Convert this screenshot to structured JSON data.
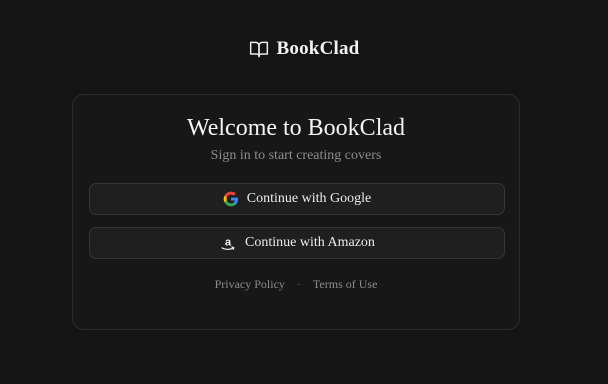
{
  "brand": {
    "name": "BookClad",
    "icon": "open-book-icon"
  },
  "card": {
    "title": "Welcome to BookClad",
    "subtitle": "Sign in to start creating covers"
  },
  "buttons": {
    "google": {
      "label": "Continue with Google",
      "icon": "google-icon"
    },
    "amazon": {
      "label": "Continue with Amazon",
      "icon": "amazon-icon"
    }
  },
  "footer": {
    "privacy": "Privacy Policy",
    "separator": "·",
    "terms": "Terms of Use"
  },
  "colors": {
    "background": "#141414",
    "card": "#171717",
    "button": "#1f1f1f",
    "text": "#f4f4f4",
    "muted": "#8c8c8c"
  }
}
